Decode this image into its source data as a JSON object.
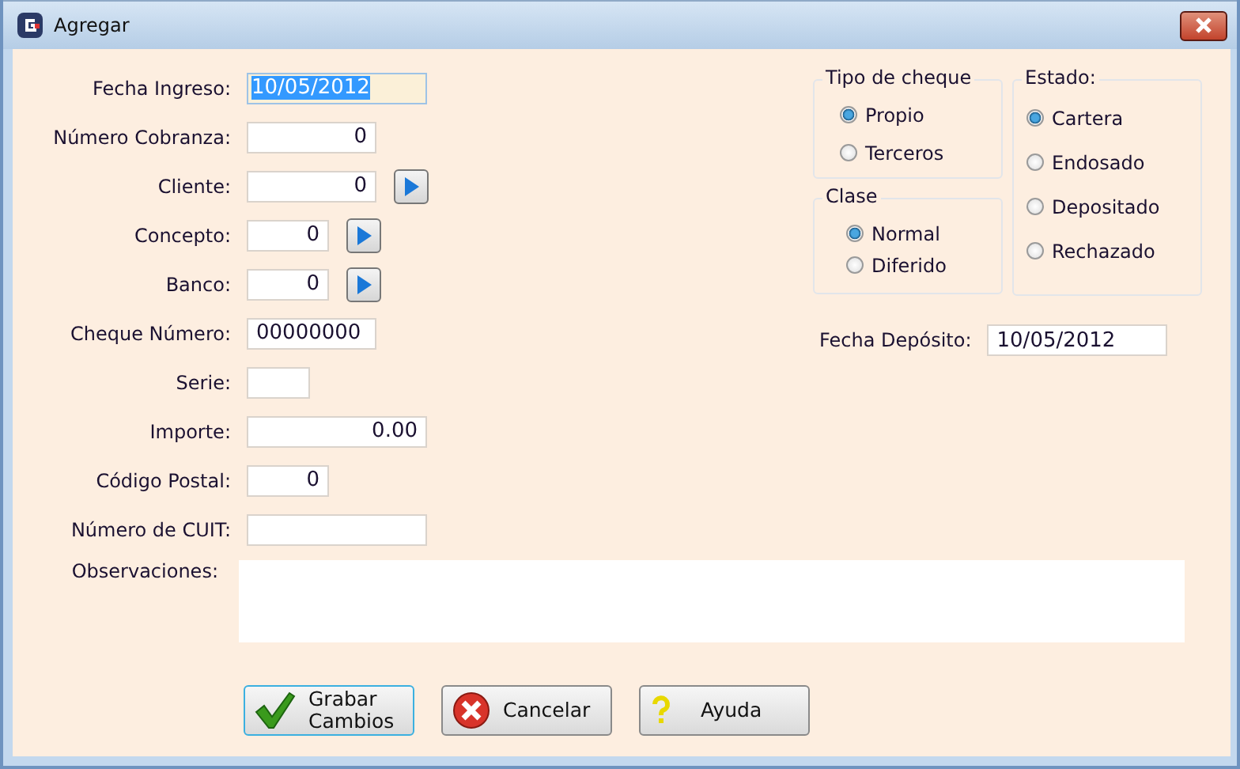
{
  "window": {
    "title": "Agregar"
  },
  "fields": [
    {
      "label": "Fecha Ingreso:",
      "value": "10/05/2012",
      "kind": "date",
      "focused": true,
      "lookup": false
    },
    {
      "label": "Número Cobranza:",
      "value": "0",
      "kind": "number",
      "focused": false,
      "lookup": false
    },
    {
      "label": "Cliente:",
      "value": "0",
      "kind": "number",
      "focused": false,
      "lookup": true
    },
    {
      "label": "Concepto:",
      "value": "0",
      "kind": "id",
      "focused": false,
      "lookup": true
    },
    {
      "label": "Banco:",
      "value": "0",
      "kind": "id",
      "focused": false,
      "lookup": true
    },
    {
      "label": "Cheque Número:",
      "value": "00000000",
      "kind": "code",
      "focused": false,
      "lookup": false
    },
    {
      "label": "Serie:",
      "kind": "short",
      "focused": false,
      "lookup": false
    },
    {
      "label": "Importe:",
      "value": "0.00",
      "kind": "amount",
      "focused": false,
      "lookup": false
    },
    {
      "label": "Código Postal:",
      "value": "0",
      "kind": "id",
      "focused": false,
      "lookup": false
    },
    {
      "label": "Número de CUIT:",
      "kind": "text",
      "focused": false,
      "lookup": false
    }
  ],
  "observaciones": {
    "label": "Observaciones:"
  },
  "tipo_de_cheque": {
    "title": "Tipo de cheque",
    "options": [
      {
        "label": "Propio",
        "selected": true
      },
      {
        "label": "Terceros",
        "selected": false
      }
    ]
  },
  "clase": {
    "title": "Clase",
    "options": [
      {
        "label": "Normal",
        "selected": true
      },
      {
        "label": "Diferido",
        "selected": false
      }
    ]
  },
  "estado": {
    "title": "Estado:",
    "options": [
      {
        "label": "Cartera",
        "selected": true
      },
      {
        "label": "Endosado",
        "selected": false
      },
      {
        "label": "Depositado",
        "selected": false
      },
      {
        "label": "Rechazado",
        "selected": false
      }
    ]
  },
  "fecha_deposito": {
    "label": "Fecha Depósito:",
    "value": "10/05/2012"
  },
  "buttons": [
    {
      "label": "Grabar Cambios",
      "kind": "save",
      "focused": true
    },
    {
      "label": "Cancelar",
      "kind": "cancel",
      "focused": false
    },
    {
      "label": "Ayuda",
      "kind": "help",
      "focused": false
    }
  ]
}
